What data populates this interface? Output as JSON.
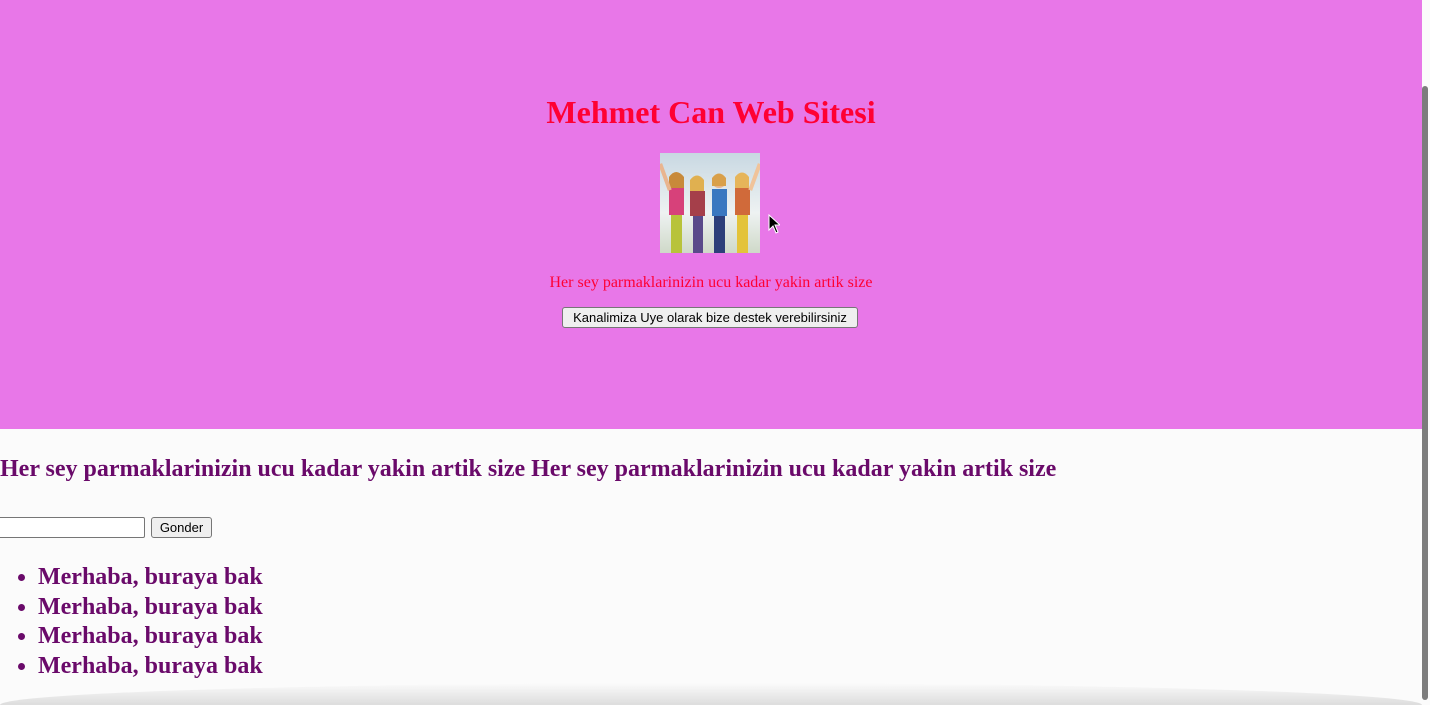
{
  "hero": {
    "title": "Mehmet Can Web Sitesi",
    "text": "Her sey parmaklarinizin ucu kadar yakin artik size",
    "button_label": "Kanalimiza Uye olarak bize destek verebilirsiniz",
    "background_color": "#e877e8",
    "accent_color": "#ff0033"
  },
  "content": {
    "heading": "Her sey parmaklarinizin ucu kadar yakin artik size Her sey parmaklarinizin ucu kadar yakin artik size",
    "input_value": "",
    "send_label": "Gonder",
    "list_items": [
      "Merhaba, buraya bak",
      "Merhaba, buraya bak",
      "Merhaba, buraya bak",
      "Merhaba, buraya bak"
    ],
    "text_color": "#6a0a6a"
  }
}
